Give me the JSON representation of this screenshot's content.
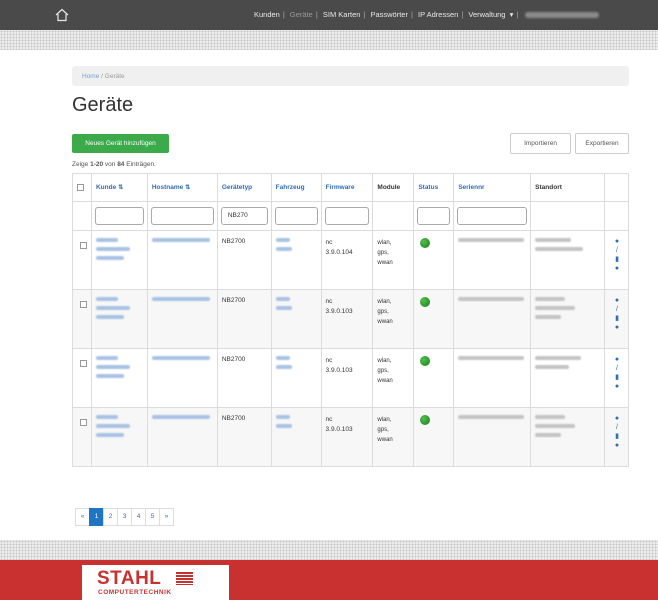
{
  "colors": {
    "topbar": "#4a4a4a",
    "primary_link": "#2f6db5",
    "new_button": "#3caa4b",
    "status_online": "#2e9a30",
    "footer_brand": "#c8312f",
    "pagination_active": "#1f74c4"
  },
  "topbar": {
    "home_icon": "home-icon",
    "nav": [
      "Kunden",
      "Geräte",
      "SIM Karten",
      "Passwörter",
      "IP Adressen",
      "Verwaltung"
    ],
    "user_dropdown": "▾"
  },
  "breadcrumb": {
    "home": "Home",
    "current": "Geräte"
  },
  "page": {
    "title": "Geräte",
    "new_button": "Neues Gerät hinzufügen",
    "import_button": "Importieren",
    "export_button": "Exportieren",
    "counter": {
      "prefix": "Zeige ",
      "range": "1-20",
      "middle": " von ",
      "total": "84",
      "suffix": " Einträgen."
    }
  },
  "table": {
    "columns": [
      "Kunde",
      "Hostname",
      "Gerätetyp",
      "Fahrzeug",
      "Firmware",
      "Module",
      "Status",
      "Seriennr",
      "Standort"
    ],
    "filter_geraetetyp": "NB270",
    "rows": [
      {
        "geraetetyp": "NB2700",
        "firmware_prefix": "nc",
        "firmware_version": "3.9.0.104",
        "modules": [
          "wlan,",
          "gps,",
          "wwan"
        ],
        "status": "online"
      },
      {
        "geraetetyp": "NB2700",
        "firmware_prefix": "nc",
        "firmware_version": "3.9.0.103",
        "modules": [
          "wlan,",
          "gps,",
          "wwan"
        ],
        "status": "online"
      },
      {
        "geraetetyp": "NB2700",
        "firmware_prefix": "nc",
        "firmware_version": "3.9.0.103",
        "modules": [
          "wlan,",
          "gps,",
          "wwan"
        ],
        "status": "online"
      },
      {
        "geraetetyp": "NB2700",
        "firmware_prefix": "nc",
        "firmware_version": "3.9.0.103",
        "modules": [
          "wlan,",
          "gps,",
          "wwan"
        ],
        "status": "online"
      }
    ],
    "row_actions": [
      "view-icon",
      "edit-icon",
      "delete-icon",
      "refresh-icon"
    ]
  },
  "pagination": {
    "prev": "«",
    "pages": [
      "1",
      "2",
      "3",
      "4",
      "5"
    ],
    "next": "»",
    "active": "1"
  },
  "footer": {
    "logo_main": "STAHL",
    "logo_sub": "COMPUTERTECHNIK"
  }
}
